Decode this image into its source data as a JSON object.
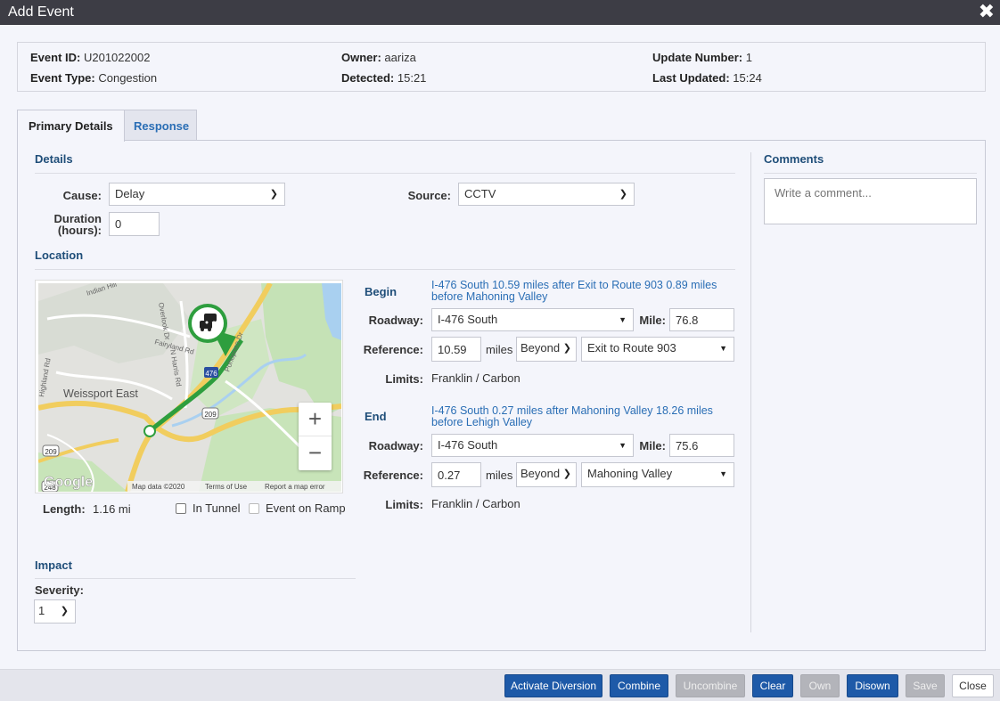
{
  "window": {
    "title": "Add Event",
    "close_icon": "close-icon"
  },
  "info": {
    "event_id_label": "Event ID:",
    "event_id": "U201022002",
    "event_type_label": "Event Type:",
    "event_type": "Congestion",
    "owner_label": "Owner:",
    "owner": "aariza",
    "detected_label": "Detected:",
    "detected": "15:21",
    "update_number_label": "Update Number:",
    "update_number": "1",
    "last_updated_label": "Last Updated:",
    "last_updated": "15:24"
  },
  "tabs": [
    {
      "label": "Primary Details",
      "active": true
    },
    {
      "label": "Response",
      "active": false
    }
  ],
  "details": {
    "title": "Details",
    "cause_label": "Cause:",
    "cause": "Delay",
    "source_label": "Source:",
    "source": "CCTV",
    "duration_label_1": "Duration",
    "duration_label_2": "(hours):",
    "duration": "0"
  },
  "location": {
    "title": "Location",
    "begin": {
      "label": "Begin",
      "description": "I-476 South 10.59 miles after Exit to Route 903 0.89 miles before Mahoning Valley",
      "roadway_label": "Roadway:",
      "roadway": "I-476 South",
      "mile_label": "Mile:",
      "mile": "76.8",
      "reference_label": "Reference:",
      "reference": "10.59",
      "miles_label": "miles",
      "direction": "Beyond",
      "landmark": "Exit to Route 903",
      "limits_label": "Limits:",
      "limits": "Franklin / Carbon"
    },
    "end": {
      "label": "End",
      "description": "I-476 South 0.27 miles after Mahoning Valley 18.26 miles before Lehigh Valley",
      "roadway_label": "Roadway:",
      "roadway": "I-476 South",
      "mile_label": "Mile:",
      "mile": "75.6",
      "reference_label": "Reference:",
      "reference": "0.27",
      "miles_label": "miles",
      "direction": "Beyond",
      "landmark": "Mahoning Valley",
      "limits_label": "Limits:",
      "limits": "Franklin / Carbon"
    },
    "length_label": "Length:",
    "length": "1.16 mi",
    "in_tunnel_label": "In Tunnel",
    "event_on_ramp_label": "Event on Ramp"
  },
  "map": {
    "labels": {
      "weissport_east": "Weissport East",
      "indian_hill": "Indian Hill",
      "overlook": "Overlook Dr",
      "fairyland": "Fairyland Rd",
      "harris": "N Harris Rd",
      "pohopoco": "Pohopoco Dr",
      "highland": "Highland Rd",
      "route_209a": "209",
      "route_209b": "209",
      "route_209c": "209",
      "route_248": "248",
      "i476": "476"
    },
    "zoom_in": "+",
    "zoom_out": "−",
    "google": "Google",
    "map_data": "Map data ©2020",
    "terms": "Terms of Use",
    "report": "Report a map error"
  },
  "impact": {
    "title": "Impact",
    "severity_label": "Severity:",
    "severity": "1"
  },
  "comments": {
    "title": "Comments",
    "placeholder": "Write a comment..."
  },
  "buttons": {
    "activate_diversion": "Activate Diversion",
    "combine": "Combine",
    "uncombine": "Uncombine",
    "clear": "Clear",
    "own": "Own",
    "disown": "Disown",
    "save": "Save",
    "close": "Close"
  },
  "colors": {
    "title_bar": "#3d3d45",
    "primary_button": "#1e5aa8",
    "disabled_button": "#b3b4ba",
    "section_title": "#1f4e79",
    "link": "#2a6eb5",
    "route": "#2e9e3e"
  }
}
